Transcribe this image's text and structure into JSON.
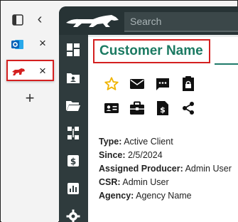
{
  "browser": {
    "tabs": [
      {
        "name": "outlook",
        "icon": "outlook-icon",
        "close": "×"
      },
      {
        "name": "customer",
        "icon": "panther-logo-icon",
        "close": "×",
        "active": true
      }
    ],
    "back_glyph": "‹",
    "new_tab_glyph": "+"
  },
  "app": {
    "search_placeholder": "Search",
    "accent_color": "#1b7a62",
    "rail_icons": [
      "dashboard-icon",
      "contact-card-folder-icon",
      "folder-icon",
      "org-chart-icon",
      "billing-icon",
      "reports-icon",
      "settings-icon"
    ]
  },
  "customer": {
    "title": "Customer Name",
    "actions": [
      "star-icon",
      "email-icon",
      "message-icon",
      "locked-document-icon",
      "id-card-icon",
      "briefcase-icon",
      "invoice-icon",
      "share-icon"
    ],
    "fields": [
      {
        "label": "Type:",
        "value": "Active Client"
      },
      {
        "label": "Since:",
        "value": "2/5/2024"
      },
      {
        "label": "Assigned Producer:",
        "value": "Admin User"
      },
      {
        "label": "CSR:",
        "value": "Admin User"
      },
      {
        "label": "Agency:",
        "value": "Agency Name"
      }
    ]
  }
}
